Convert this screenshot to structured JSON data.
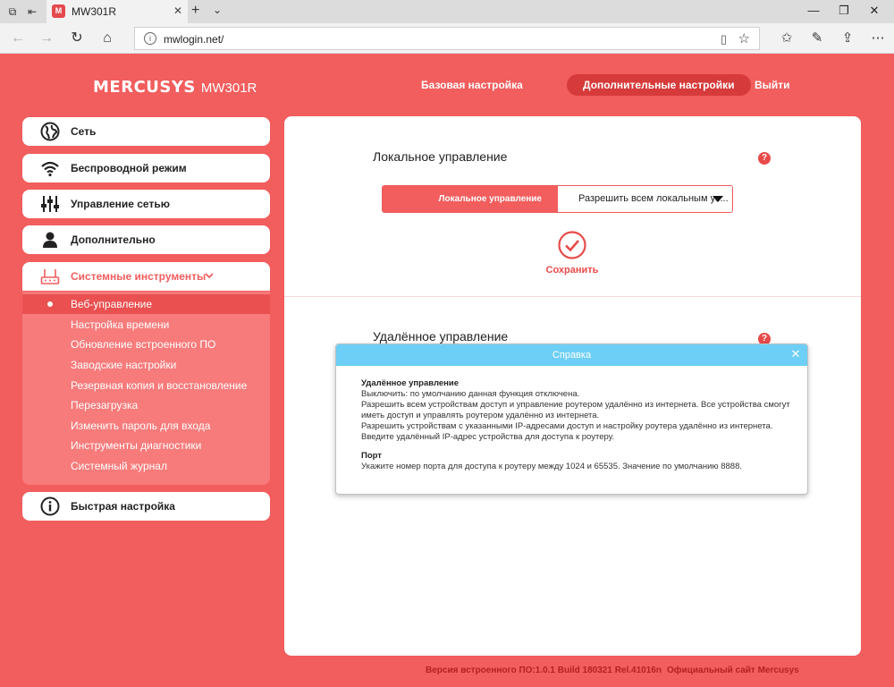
{
  "browser": {
    "tab_title": "MW301R",
    "tab_favicon_letter": "M",
    "address": "mwlogin.net/",
    "tab_close": "✕",
    "new_tab": "+",
    "tab_menu": "⌄"
  },
  "header": {
    "brand": "MERCUSYS",
    "model": "MW301R",
    "nav": {
      "basic": "Базовая настройка",
      "advanced": "Дополнительные настройки",
      "logout": "Выйти"
    }
  },
  "sidebar": {
    "items": [
      {
        "label": "Сеть",
        "icon": "globe-icon"
      },
      {
        "label": "Беспроводной режим",
        "icon": "wifi-icon"
      },
      {
        "label": "Управление сетью",
        "icon": "sliders-icon"
      },
      {
        "label": "Дополнительно",
        "icon": "user-icon"
      },
      {
        "label": "Системные инструменты",
        "icon": "router-icon"
      },
      {
        "label": "Быстрая настройка",
        "icon": "info-icon"
      }
    ],
    "submenu": [
      "Веб-управление",
      "Настройка времени",
      "Обновление встроенного ПО",
      "Заводские настройки",
      "Резервная копия и восстановление",
      "Перезагрузка",
      "Изменить пароль для входа",
      "Инструменты диагностики",
      "Системный журнал"
    ],
    "active_submenu_index": 0
  },
  "main": {
    "local": {
      "title": "Локальное управление",
      "field_label": "Локальное управление",
      "field_value": "Разрешить всем локальным ус...",
      "save_label": "Сохранить"
    },
    "remote": {
      "title": "Удалённое управление"
    }
  },
  "help_dialog": {
    "title": "Справка",
    "section1_heading": "Удалённое управление",
    "section1_lines": [
      "Выключить: по умолчанию данная функция отключена.",
      "Разрешить всем устройствам доступ и управление роутером удалённо из интернета. Все устройства смогут иметь доступ и управлять роутером удалённо из интернета.",
      "Разрешить устройствам с указанными IP-адресами доступ и настройку роутера удалённо из интернета. Введите удалённый IP-адрес устройства для доступа к роутеру."
    ],
    "section2_heading": "Порт",
    "section2_lines": [
      "Укажите номер порта для доступа к роутеру между 1024 и 65535. Значение по умолчанию 8888."
    ]
  },
  "footer": {
    "firmware": "Версия встроенного ПО:1.0.1 Build 180321 Rel.41016n",
    "site_link": "Официальный сайт Mercusys"
  },
  "colors": {
    "brand_red": "#f25d5d",
    "dialog_header": "#6ecff6",
    "active_nav": "#d63a3a"
  }
}
